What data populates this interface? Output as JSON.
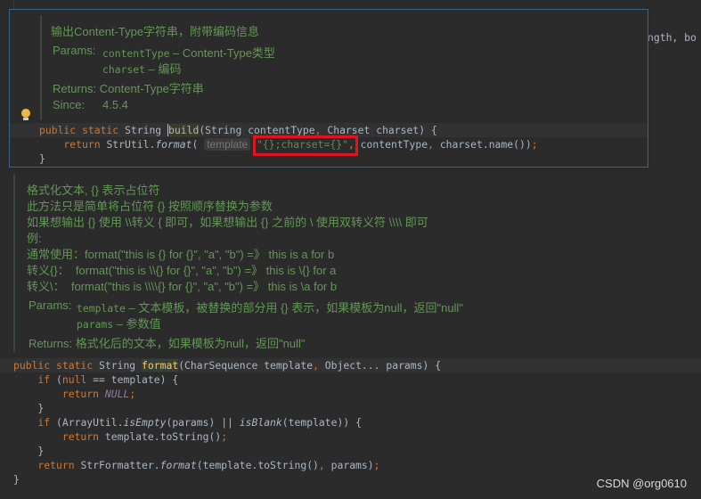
{
  "background_code": {
    "tail": "ngth, bo"
  },
  "popup": {
    "summary": "输出Content-Type字符串，附带编码信息",
    "params_label": "Params:",
    "params": [
      {
        "name": "contentType",
        "desc": " – Content-Type类型"
      },
      {
        "name": "charset",
        "desc": " – 编码"
      }
    ],
    "returns_label": "Returns:",
    "returns": "Content-Type字符串",
    "since_label": "Since:",
    "since": "4.5.4",
    "bulb_icon": "lightbulb-icon",
    "highlight_color": "#e0141e",
    "code": [
      [
        {
          "t": "public static ",
          "c": "kw"
        },
        {
          "t": "String "
        },
        {
          "t": "build",
          "c": "cur"
        },
        {
          "t": "(String contentType"
        },
        {
          "t": ", ",
          "c": "kw"
        },
        {
          "t": "Charset charset) {"
        }
      ],
      [
        {
          "t": "    return ",
          "c": "kw"
        },
        {
          "t": "StrUtil."
        },
        {
          "t": "format",
          "c": "it"
        },
        {
          "t": "( "
        },
        {
          "t": "template",
          "c": "hint"
        },
        {
          "t": " "
        },
        {
          "t": "\"{};charset={}\"",
          "c": "str"
        },
        {
          "t": ", ",
          "c": "kw"
        },
        {
          "t": "contentType"
        },
        {
          "t": ", ",
          "c": "kw"
        },
        {
          "t": "charset.name())"
        },
        {
          "t": ";",
          "c": "kw"
        }
      ],
      [
        {
          "t": "}"
        }
      ]
    ]
  },
  "doc": {
    "lines": [
      "格式化文本, {} 表示占位符",
      "此方法只是简单将占位符 {} 按照顺序替换为参数",
      "如果想输出 {} 使用 \\\\转义 { 即可，如果想输出 {} 之前的 \\ 使用双转义符 \\\\\\\\ 即可",
      "例:",
      "通常使用：format(\"this is {} for {}\", \"a\", \"b\") =》 this is a for b",
      "转义{}：  format(\"this is \\\\{} for {}\", \"a\", \"b\") =》 this is \\{} for a",
      "转义\\：  format(\"this is \\\\\\\\{} for {}\", \"a\", \"b\") =》 this is \\a for b"
    ],
    "params_label": "Params:",
    "params": [
      {
        "name": "template",
        "desc": " – 文本模板，被替换的部分用 {} 表示，如果模板为null，返回\"null\""
      },
      {
        "name": "params",
        "desc": " – 参数值"
      }
    ],
    "returns_label": "Returns:",
    "returns": "格式化后的文本，如果模板为null，返回\"null\""
  },
  "code": [
    [
      {
        "t": "public static ",
        "c": "kw"
      },
      {
        "t": "String "
      },
      {
        "t": "format",
        "c": "hl"
      },
      {
        "t": "(CharSequence template"
      },
      {
        "t": ", ",
        "c": "kw"
      },
      {
        "t": "Object... params) {"
      }
    ],
    [
      {
        "t": "    if ",
        "c": "kw"
      },
      {
        "t": "("
      },
      {
        "t": "null ",
        "c": "kw"
      },
      {
        "t": "== template) {"
      }
    ],
    [
      {
        "t": "        return ",
        "c": "kw"
      },
      {
        "t": "NULL",
        "c": "const"
      },
      {
        "t": ";",
        "c": "kw"
      }
    ],
    [
      {
        "t": "    }"
      }
    ],
    [
      {
        "t": "    if ",
        "c": "kw"
      },
      {
        "t": "(ArrayUtil."
      },
      {
        "t": "isEmpty",
        "c": "it"
      },
      {
        "t": "(params) || "
      },
      {
        "t": "isBlank",
        "c": "it"
      },
      {
        "t": "(template)) {"
      }
    ],
    [
      {
        "t": "        return ",
        "c": "kw"
      },
      {
        "t": "template.toString()"
      },
      {
        "t": ";",
        "c": "kw"
      }
    ],
    [
      {
        "t": "    }"
      }
    ],
    [
      {
        "t": "    return ",
        "c": "kw"
      },
      {
        "t": "StrFormatter."
      },
      {
        "t": "format",
        "c": "it"
      },
      {
        "t": "(template.toString()"
      },
      {
        "t": ", ",
        "c": "kw"
      },
      {
        "t": "params)"
      },
      {
        "t": ";",
        "c": "kw"
      }
    ],
    [
      {
        "t": "}"
      }
    ]
  ],
  "watermark": "CSDN @org0610"
}
